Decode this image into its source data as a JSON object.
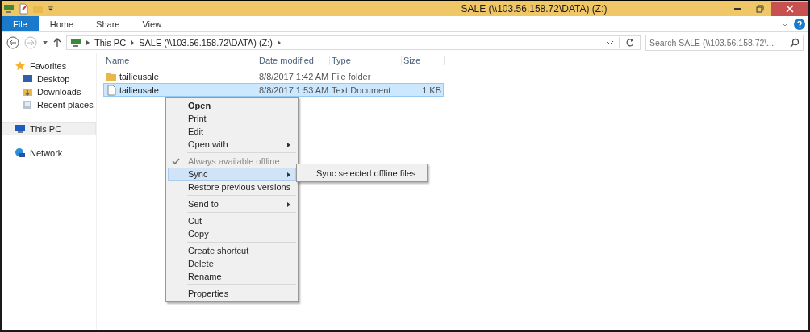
{
  "window": {
    "title": "SALE (\\\\103.56.158.72\\DATA) (Z:)"
  },
  "ribbon_tabs": [
    {
      "label": "File",
      "selected": true
    },
    {
      "label": "Home",
      "selected": false
    },
    {
      "label": "Share",
      "selected": false
    },
    {
      "label": "View",
      "selected": false
    }
  ],
  "breadcrumb": [
    "This PC",
    "SALE (\\\\103.56.158.72\\DATA) (Z:)"
  ],
  "search": {
    "placeholder": "Search SALE (\\\\103.56.158.72\\..."
  },
  "sidebar": [
    {
      "label": "Favorites",
      "kind": "star",
      "selected": false,
      "children": [
        {
          "label": "Desktop",
          "kind": "desktop",
          "selected": false
        },
        {
          "label": "Downloads",
          "kind": "downloads",
          "selected": false
        },
        {
          "label": "Recent places",
          "kind": "recent",
          "selected": false
        }
      ]
    },
    {
      "label": "This PC",
      "kind": "pc",
      "selected": true
    },
    {
      "label": "Network",
      "kind": "network",
      "selected": false
    }
  ],
  "table": {
    "columns": [
      "Name",
      "Date modified",
      "Type",
      "Size"
    ],
    "rows": [
      {
        "kind": "folder",
        "name": "tailieusale",
        "date": "8/8/2017 1:42 AM",
        "type": "File folder",
        "selected": false
      },
      {
        "kind": "text",
        "name": "tailieusale",
        "date": "8/8/2017 1:53 AM",
        "type": "Text Document",
        "size": "1 KB",
        "selected": true
      }
    ]
  },
  "context_menu": {
    "groups": [
      [
        {
          "label": "Open",
          "default": true,
          "checked": false,
          "disabled": false,
          "selected": false,
          "submenu": false
        },
        {
          "label": "Print",
          "default": false,
          "checked": false,
          "disabled": false,
          "selected": false,
          "submenu": false
        },
        {
          "label": "Edit",
          "default": false,
          "checked": false,
          "disabled": false,
          "selected": false,
          "submenu": false
        },
        {
          "label": "Open with",
          "default": false,
          "checked": false,
          "disabled": false,
          "selected": false,
          "submenu": true
        }
      ],
      [
        {
          "label": "Always available offline",
          "default": false,
          "checked": true,
          "disabled": true,
          "selected": false,
          "submenu": false
        },
        {
          "label": "Sync",
          "default": false,
          "checked": false,
          "disabled": false,
          "selected": true,
          "submenu": true
        },
        {
          "label": "Restore previous versions",
          "default": false,
          "checked": false,
          "disabled": false,
          "selected": false,
          "submenu": false
        }
      ],
      [
        {
          "label": "Send to",
          "default": false,
          "checked": false,
          "disabled": false,
          "selected": false,
          "submenu": true
        }
      ],
      [
        {
          "label": "Cut",
          "default": false,
          "checked": false,
          "disabled": false,
          "selected": false,
          "submenu": false
        },
        {
          "label": "Copy",
          "default": false,
          "checked": false,
          "disabled": false,
          "selected": false,
          "submenu": false
        }
      ],
      [
        {
          "label": "Create shortcut",
          "default": false,
          "checked": false,
          "disabled": false,
          "selected": false,
          "submenu": false
        },
        {
          "label": "Delete",
          "default": false,
          "checked": false,
          "disabled": false,
          "selected": false,
          "submenu": false
        },
        {
          "label": "Rename",
          "default": false,
          "checked": false,
          "disabled": false,
          "selected": false,
          "submenu": false
        }
      ],
      [
        {
          "label": "Properties",
          "default": false,
          "checked": false,
          "disabled": false,
          "selected": false,
          "submenu": false
        }
      ]
    ]
  },
  "submenu": {
    "items": [
      "Sync selected offline files"
    ]
  }
}
